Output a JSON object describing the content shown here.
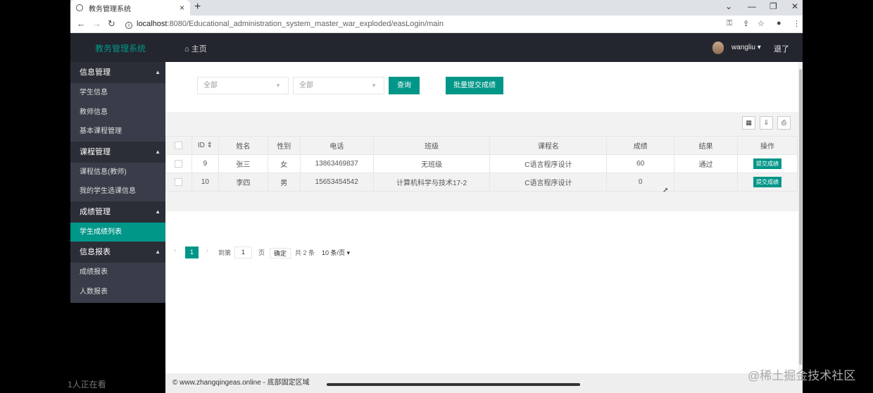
{
  "browser": {
    "tab_title": "教务管理系统",
    "tab_close": "×",
    "new_tab": "+",
    "url_host": "localhost",
    "url_rest": ":8080/Educational_administration_system_master_war_exploded/easLogin/main"
  },
  "header": {
    "logo": "教务管理系统",
    "home": "⌂ 主页",
    "username": "wangliu ▾",
    "logout": "退了"
  },
  "sidebar": {
    "groups": [
      {
        "label": "信息管理",
        "items": [
          "学生信息",
          "教师信息",
          "基本课程管理"
        ]
      },
      {
        "label": "课程管理",
        "items": [
          "课程信息(教师)",
          "我的学生选课信息"
        ]
      },
      {
        "label": "成绩管理",
        "items": [
          "学生成绩列表"
        ]
      },
      {
        "label": "信息报表",
        "items": [
          "成绩报表",
          "人数报表"
        ]
      }
    ],
    "caret": "▲"
  },
  "filters": {
    "select1": "全部",
    "select2": "全部",
    "query_btn": "查询",
    "batch_btn": "批量提交成绩"
  },
  "toolbar_icons": [
    "columns-icon",
    "export-icon",
    "print-icon"
  ],
  "table": {
    "headers": [
      "ID ⇕",
      "姓名",
      "性别",
      "电话",
      "班级",
      "课程名",
      "成绩",
      "结果",
      "操作"
    ],
    "rows": [
      {
        "id": "9",
        "name": "张三",
        "gender": "女",
        "phone": "13863469837",
        "class": "无班级",
        "course": "C语言程序设计",
        "score": "60",
        "result": "通过",
        "action": "提交成绩"
      },
      {
        "id": "10",
        "name": "李四",
        "gender": "男",
        "phone": "15653454542",
        "class": "计算机科学与技术17-2",
        "course": "C语言程序设计",
        "score": "0",
        "result": "",
        "action": "提交成绩"
      }
    ]
  },
  "pager": {
    "prev": "‹",
    "current": "1",
    "next": "›",
    "goto_label": "到第",
    "goto_value": "1",
    "page_unit": "页",
    "confirm": "确定",
    "total": "共 2 条",
    "per_page": "10 条/页 ▾"
  },
  "footer": {
    "text": "© www.zhangqingeas.online - 底部固定区域"
  },
  "overlay": {
    "viewers": "1人正在看",
    "watermark": "@稀土掘金技术社区"
  }
}
